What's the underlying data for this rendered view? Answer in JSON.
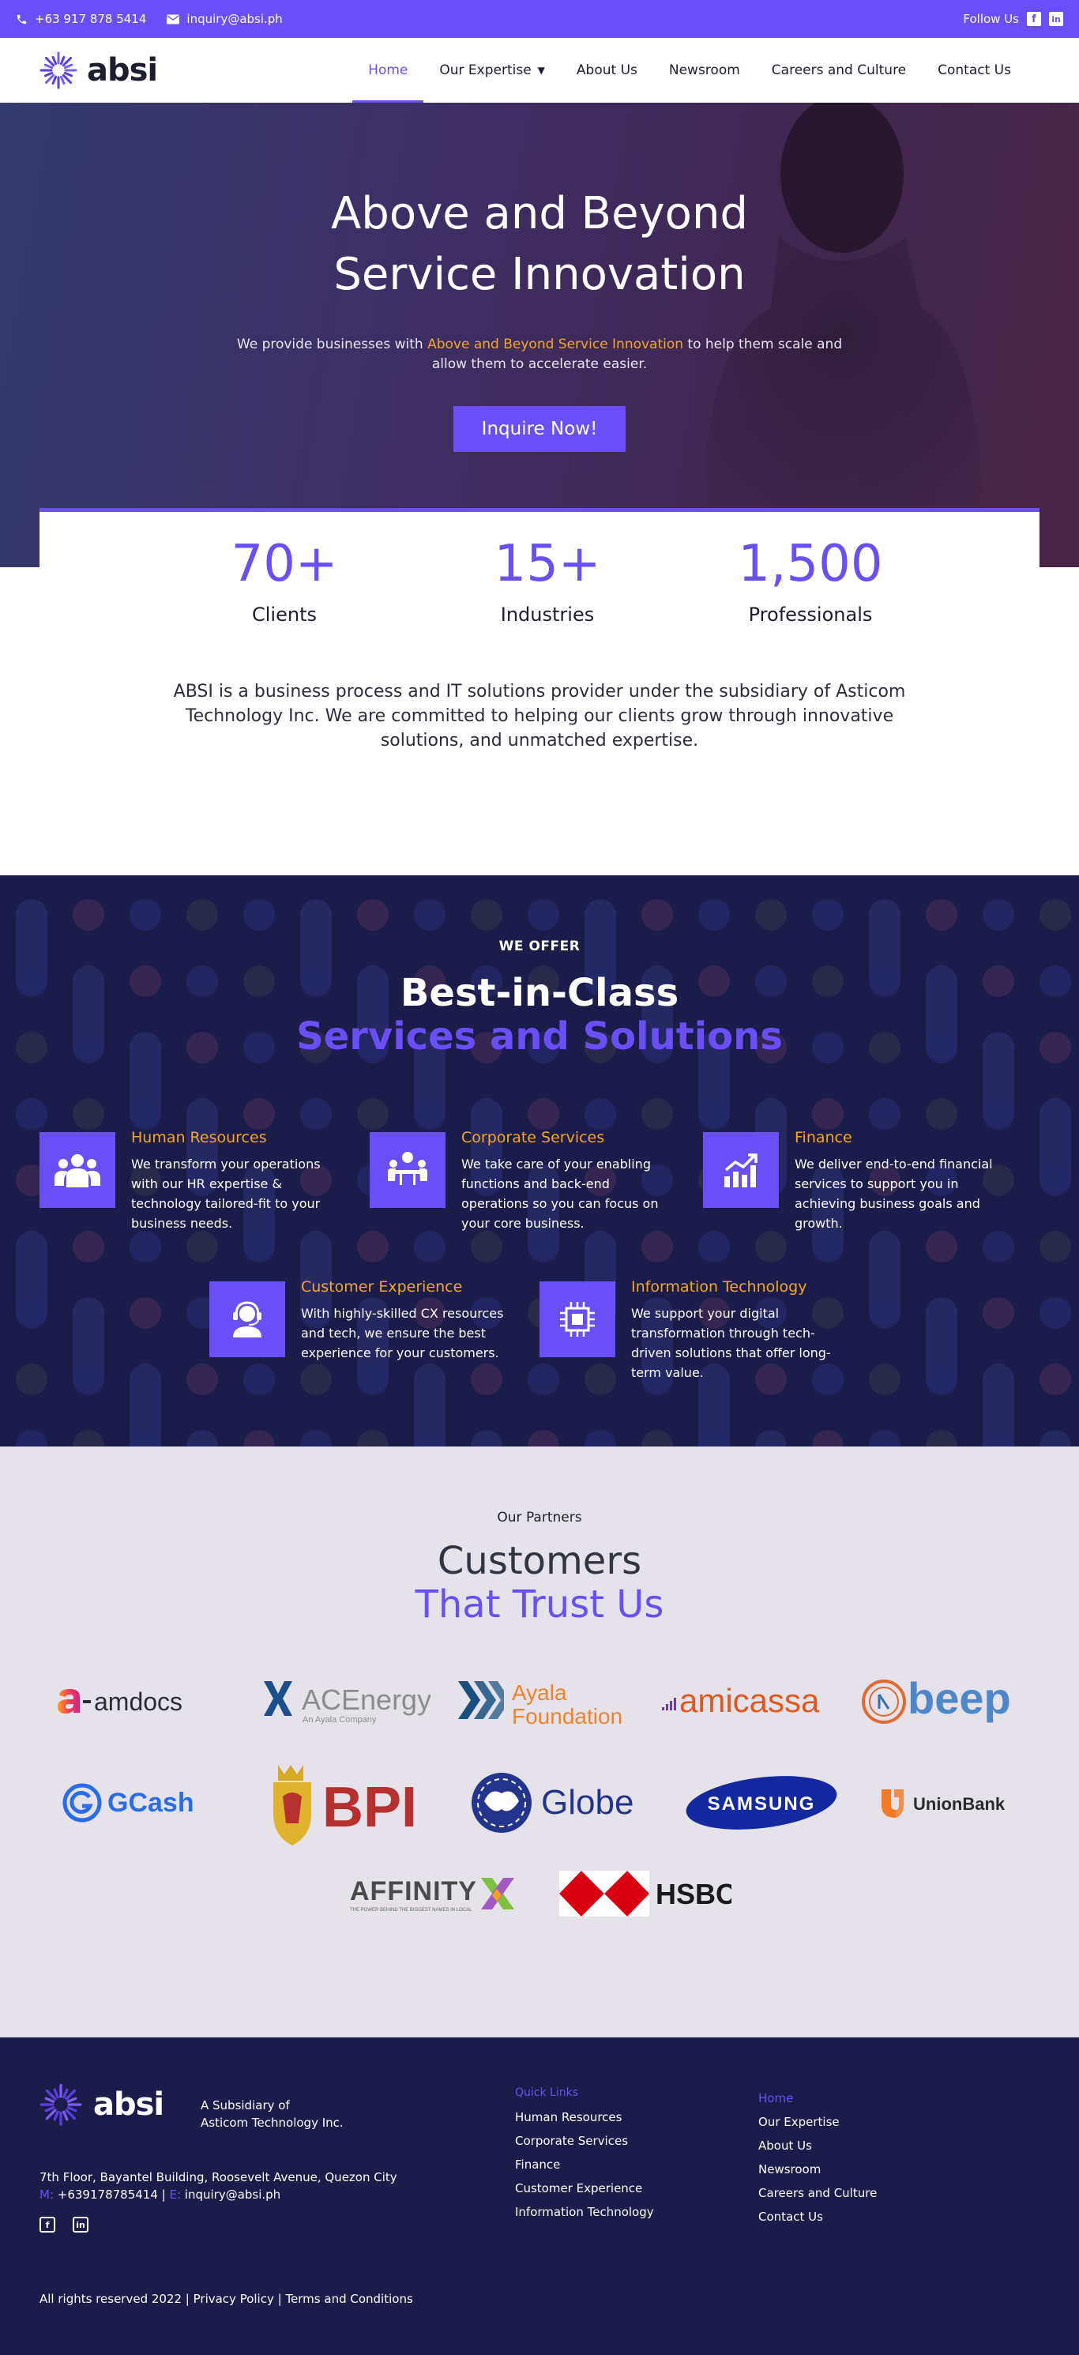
{
  "topbar": {
    "phone": "+63 917 878 5414",
    "email": "inquiry@absi.ph",
    "follow": "Follow Us",
    "social_icons": [
      "facebook-icon",
      "linkedin-icon"
    ]
  },
  "brand": {
    "name": "absi",
    "accent": "#6a4ff6",
    "highlight": "#f5a623",
    "navy": "#1c1c4b"
  },
  "nav": {
    "items": [
      {
        "label": "Home",
        "active": true
      },
      {
        "label": "Our Expertise",
        "dropdown": true
      },
      {
        "label": "About Us"
      },
      {
        "label": "Newsroom"
      },
      {
        "label": "Careers and Culture"
      },
      {
        "label": "Contact Us"
      }
    ]
  },
  "hero": {
    "title_line1": "Above and Beyond",
    "title_line2": "Service Innovation",
    "sub_before": "We provide businesses with ",
    "sub_highlight": "Above and Beyond Service Innovation",
    "sub_after": " to help them scale and allow them to accelerate easier.",
    "cta": "Inquire Now!"
  },
  "stats": [
    {
      "value": "70+",
      "label": "Clients"
    },
    {
      "value": "15+",
      "label": "Industries"
    },
    {
      "value": "1,500",
      "label": "Professionals"
    }
  ],
  "about": "ABSI is a business process and IT solutions provider under the subsidiary of Asticom Technology Inc. We are committed to helping our clients grow through innovative solutions, and unmatched expertise.",
  "services": {
    "kicker": "WE OFFER",
    "title1": "Best-in-Class",
    "title2": "Services and Solutions",
    "items": [
      {
        "name": "Human Resources",
        "icon": "team-icon",
        "desc": "We transform your operations with our HR expertise & technology tailored-fit to your business needs."
      },
      {
        "name": "Corporate Services",
        "icon": "meeting-icon",
        "desc": "We take care of your enabling functions and back-end operations so you can focus on your core business."
      },
      {
        "name": "Finance",
        "icon": "growth-chart-icon",
        "desc": "We deliver end-to-end financial services to support you in achieving business goals and growth."
      },
      {
        "name": "Customer Experience",
        "icon": "headset-agent-icon",
        "desc": "With highly-skilled CX resources and tech, we ensure the best experience for your customers."
      },
      {
        "name": "Information Technology",
        "icon": "chip-icon",
        "desc": "We support your digital transformation through tech-driven solutions that offer long-term value."
      }
    ]
  },
  "partners": {
    "kicker": "Our Partners",
    "title1": "Customers",
    "title2": "That Trust Us",
    "logos": {
      "amdocs": "amdocs",
      "acenergy": "ACEnergy",
      "acenergy_sub": "An Ayala Company",
      "ayala1": "Ayala",
      "ayala2": "Foundation",
      "amicassa": "amicassa",
      "beep": "beep",
      "gcash": "GCash",
      "bpi": "BPI",
      "globe": "Globe",
      "samsung": "SAMSUNG",
      "unionbank": "UnionBank",
      "affinity": "AFFINITY",
      "affinity_tag": "THE POWER BEHIND THE BIGGEST NAMES IN LOCAL",
      "hsbc": "HSBC"
    }
  },
  "footer": {
    "subsidiary_line1": "A Subsidiary of",
    "subsidiary_line2": "Asticom Technology Inc.",
    "address": "7th Floor, Bayantel Building, Roosevelt Avenue, Quezon City",
    "m_label": "M:",
    "mobile": "+639178785414",
    "sep": " | ",
    "e_label": "E:",
    "email": "inquiry@absi.ph",
    "quick_links_header": "Quick Links",
    "quick_links": [
      "Human Resources",
      "Corporate Services",
      "Finance",
      "Customer Experience",
      "Information Technology"
    ],
    "site_links": [
      "Home",
      "Our Expertise",
      "About Us",
      "Newsroom",
      "Careers and Culture",
      "Contact Us"
    ],
    "copyright": "All rights reserved 2022 | Privacy Policy | Terms and Conditions"
  }
}
